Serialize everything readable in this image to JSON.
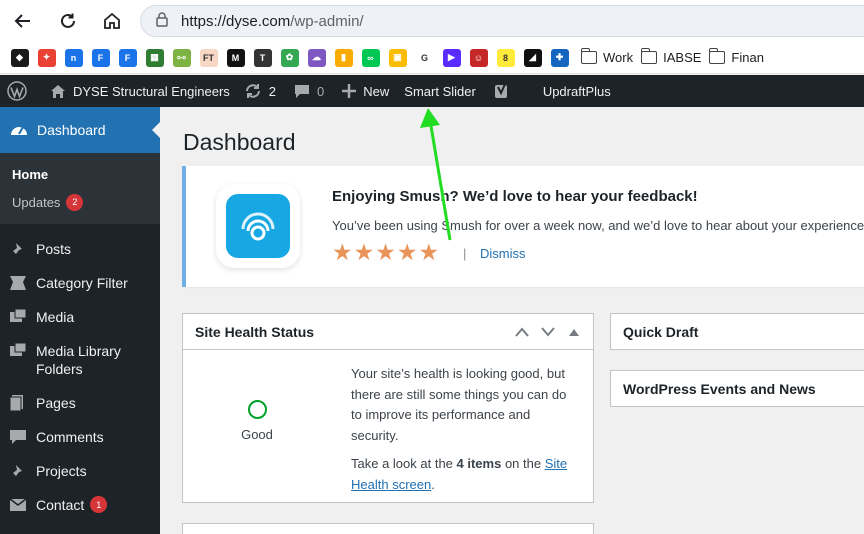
{
  "browser": {
    "url_host": "https://dyse.com",
    "url_path": "/wp-admin/",
    "bookmark_folders": [
      "Work",
      "IABSE",
      "Finan"
    ]
  },
  "bookmarks": [
    {
      "name": "bookmark-1",
      "color": "#1a1a1a",
      "glyph": "◆"
    },
    {
      "name": "bookmark-2",
      "color": "#e94235",
      "glyph": "✦"
    },
    {
      "name": "bookmark-3",
      "color": "#1a73e8",
      "glyph": "n"
    },
    {
      "name": "bookmark-4",
      "color": "#1a73e8",
      "glyph": "F"
    },
    {
      "name": "bookmark-5",
      "color": "#1a73e8",
      "glyph": "F"
    },
    {
      "name": "bookmark-6",
      "color": "#2e7d32",
      "glyph": "▦"
    },
    {
      "name": "bookmark-7",
      "color": "#7cb342",
      "glyph": "⧟"
    },
    {
      "name": "bookmark-8",
      "color": "#f7d7c4",
      "glyph": "FT"
    },
    {
      "name": "bookmark-9",
      "color": "#111111",
      "glyph": "M"
    },
    {
      "name": "bookmark-10",
      "color": "#333333",
      "glyph": "T"
    },
    {
      "name": "bookmark-11",
      "color": "#34a853",
      "glyph": "✿"
    },
    {
      "name": "bookmark-12",
      "color": "#7e57c2",
      "glyph": "☁"
    },
    {
      "name": "bookmark-13",
      "color": "#f9ab00",
      "glyph": "▮"
    },
    {
      "name": "bookmark-14",
      "color": "#00c853",
      "glyph": "∞"
    },
    {
      "name": "bookmark-15",
      "color": "#fbbc04",
      "glyph": "▣"
    },
    {
      "name": "bookmark-16",
      "color": "#ffffff",
      "glyph": "G"
    },
    {
      "name": "bookmark-17",
      "color": "#5b2cff",
      "glyph": "▶"
    },
    {
      "name": "bookmark-18",
      "color": "#c62828",
      "glyph": "☺"
    },
    {
      "name": "bookmark-19",
      "color": "#ffeb3b",
      "glyph": "8"
    },
    {
      "name": "bookmark-20",
      "color": "#111111",
      "glyph": "◢"
    },
    {
      "name": "bookmark-21",
      "color": "#1565c0",
      "glyph": "✚"
    }
  ],
  "adminbar": {
    "site_name": "DYSE Structural Engineers",
    "updates_count": "2",
    "comments_count": "0",
    "new_label": "New",
    "smart_slider_label": "Smart Slider",
    "updraft_label": "UpdraftPlus"
  },
  "sidebar": {
    "dashboard_label": "Dashboard",
    "home_label": "Home",
    "updates_label": "Updates",
    "updates_badge": "2",
    "items": [
      {
        "label": "Posts"
      },
      {
        "label": "Category Filter"
      },
      {
        "label": "Media"
      },
      {
        "label": "Media Library Folders"
      },
      {
        "label": "Pages"
      },
      {
        "label": "Comments"
      },
      {
        "label": "Projects"
      },
      {
        "label": "Contact",
        "badge": "1"
      }
    ]
  },
  "main": {
    "page_title": "Dashboard",
    "notice": {
      "title": "Enjoying Smush? We’d love to hear your feedback!",
      "text": "You’ve been using Smush for over a week now, and we’d love to hear about your experience! ",
      "separator": "|",
      "dismiss_label": "Dismiss",
      "stars": 5
    },
    "site_health": {
      "title": "Site Health Status",
      "status_label": "Good",
      "text": "Your site’s health is looking good, but there are still some things you can do to improve its performance and security.",
      "text2_prefix": "Take a look at the ",
      "text2_bold": "4 items",
      "text2_mid": " on the ",
      "link_label": "Site Health screen",
      "text2_suffix": "."
    },
    "quick_draft_title": "Quick Draft",
    "events_title": "WordPress Events and News"
  },
  "colors": {
    "adminbar_bg": "#1d2327",
    "accent_blue": "#2271b1",
    "badge_red": "#d63638",
    "health_green": "#00a32a",
    "star_orange": "#e8945a",
    "annotation_arrow": "#22dd22"
  }
}
